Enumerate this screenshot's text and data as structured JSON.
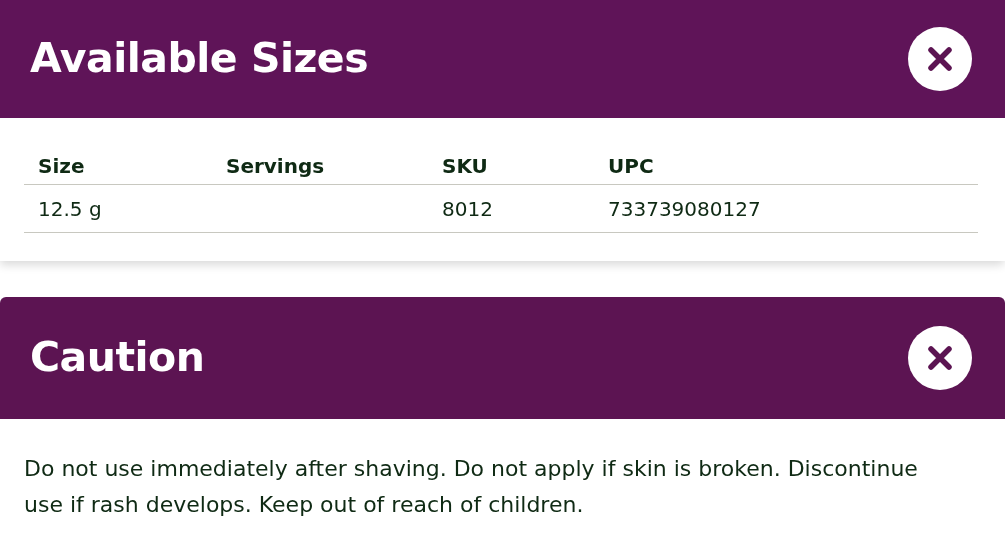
{
  "sizes_panel": {
    "title": "Available Sizes",
    "table": {
      "columns": [
        "Size",
        "Servings",
        "SKU",
        "UPC"
      ],
      "rows": [
        [
          "12.5 g",
          "",
          "8012",
          "733739080127"
        ]
      ]
    }
  },
  "caution_panel": {
    "title": "Caution",
    "text": "Do not use immediately after shaving. Do not apply if skin is broken. Discontinue use if rash develops. Keep out of reach of children."
  }
}
